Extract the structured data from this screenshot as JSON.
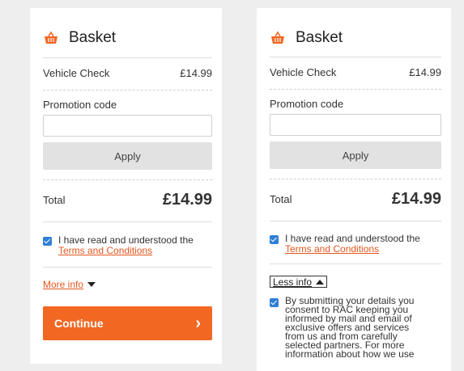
{
  "panels": {
    "left": {
      "title": "Basket",
      "item_label": "Vehicle Check",
      "item_price": "£14.99",
      "promo_label": "Promotion code",
      "promo_value": "",
      "promo_placeholder": "",
      "apply_label": "Apply",
      "total_label": "Total",
      "total_value": "£14.99",
      "terms_text": "I have read and understood the",
      "terms_link": "Terms and Conditions",
      "more_info": "More info",
      "continue_label": "Continue",
      "continue_chevron": "›"
    },
    "right": {
      "title": "Basket",
      "item_label": "Vehicle Check",
      "item_price": "£14.99",
      "promo_label": "Promotion code",
      "promo_value": "",
      "promo_placeholder": "",
      "apply_label": "Apply",
      "total_label": "Total",
      "total_value": "£14.99",
      "terms_text": "I have read and understood the",
      "terms_link": "Terms and Conditions",
      "less_info": "Less info",
      "consent_text": "By submitting your details you consent to RAC keeping you informed by mail and email of exclusive offers and services from us and from carefully selected partners. For more information about how we use"
    }
  },
  "colors": {
    "accent": "#f26722",
    "link": "#e4561e",
    "checkbox": "#2f7fd6",
    "apply_bg": "#e2e2e2",
    "page_bg": "#eeeeee"
  },
  "icons": {
    "basket": "basket-icon",
    "checkbox": "checkbox-checked-icon",
    "more": "triangle-down-icon",
    "less": "triangle-up-icon",
    "continue": "chevron-right-icon"
  }
}
